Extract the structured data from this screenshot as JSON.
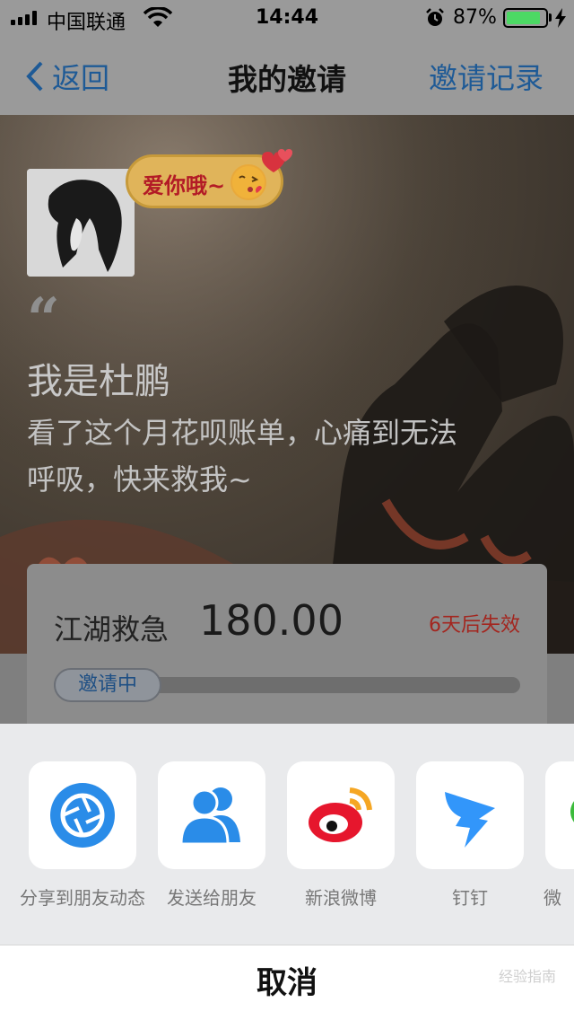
{
  "status_bar": {
    "carrier": "中国联通",
    "time": "14:44",
    "battery_percent": "87%",
    "battery_level": 0.87,
    "icons": [
      "signal-icon",
      "wifi-icon",
      "alarm-icon",
      "battery-icon",
      "charging-bolt-icon"
    ]
  },
  "nav": {
    "back_label": "返回",
    "title": "我的邀请",
    "right_label": "邀请记录",
    "accent_color": "#1e5a96"
  },
  "hero": {
    "bubble_text": "爱你哦~",
    "quote_mark": "“",
    "name": "我是杜鹏",
    "message": "看了这个月花呗账单，心痛到无法呼吸，快来救我~"
  },
  "card": {
    "label": "江湖救急",
    "amount": "180.00",
    "expire": "6天后失效",
    "status": "邀请中",
    "expire_color": "#a3261f"
  },
  "share": {
    "items": [
      {
        "label": "分享到朋友动态",
        "icon": "shutter-icon",
        "color": "#2a8ce8"
      },
      {
        "label": "发送给朋友",
        "icon": "contacts-icon",
        "color": "#2a8ce8"
      },
      {
        "label": "新浪微博",
        "icon": "weibo-icon",
        "color": "#e6162d"
      },
      {
        "label": "钉钉",
        "icon": "dingtalk-icon",
        "color": "#3296fa"
      },
      {
        "label": "微",
        "icon": "wechat-icon",
        "color": "#3bbb3b"
      }
    ],
    "cancel_label": "取消"
  },
  "watermark": "经验指南"
}
